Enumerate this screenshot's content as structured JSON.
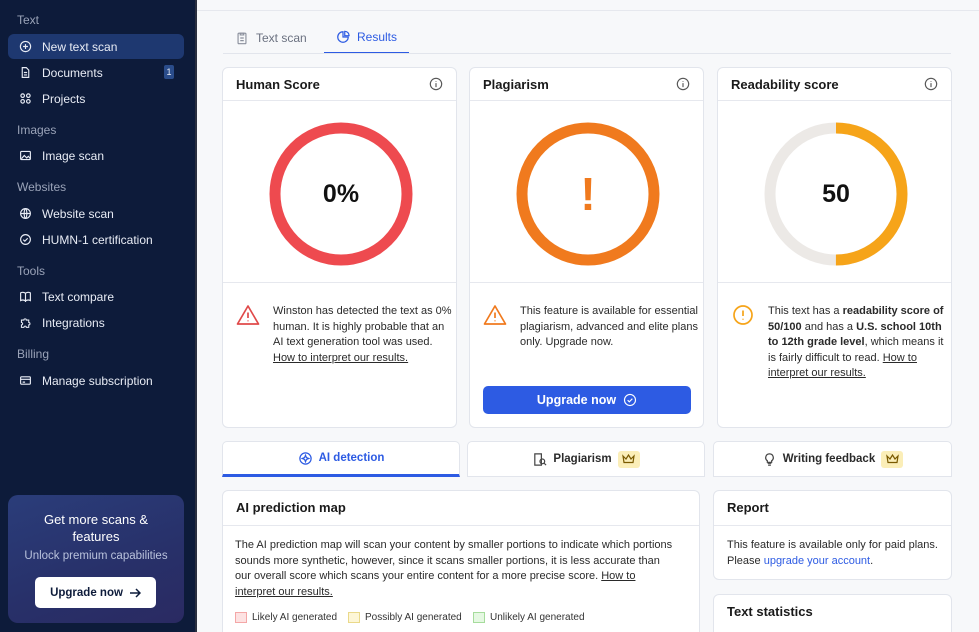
{
  "sidebar": {
    "sections": {
      "text": "Text",
      "images": "Images",
      "websites": "Websites",
      "tools": "Tools",
      "billing": "Billing"
    },
    "items": {
      "new_text_scan": "New text scan",
      "documents": "Documents",
      "documents_badge": "1",
      "projects": "Projects",
      "image_scan": "Image scan",
      "website_scan": "Website scan",
      "humn_cert": "HUMN-1 certification",
      "text_compare": "Text compare",
      "integrations": "Integrations",
      "manage_subscription": "Manage subscription"
    },
    "promo": {
      "title": "Get more scans & features",
      "subtitle": "Unlock premium capabilities",
      "button": "Upgrade now"
    }
  },
  "tabs": {
    "text_scan": "Text scan",
    "results": "Results"
  },
  "cards": {
    "human": {
      "title": "Human Score",
      "value": "0%",
      "score_percent": 0,
      "msg": "Winston has detected the text as 0% human. It is highly probable that an AI text generation tool was used.",
      "link": "How to interpret our results."
    },
    "plagiarism": {
      "title": "Plagiarism",
      "value": "!",
      "msg": "This feature is available for essential plagiarism, advanced and elite plans only. Upgrade now.",
      "button": "Upgrade now"
    },
    "readability": {
      "title": "Readability score",
      "value": "50",
      "score": 50,
      "msg_1": "This text has a ",
      "msg_b1": "readability score of 50/100",
      "msg_2": " and has a ",
      "msg_b2": "U.S. school 10th to 12th grade level",
      "msg_3": ", which means it is fairly difficult to read. ",
      "link": "How to interpret our results."
    }
  },
  "subtabs": {
    "ai_detection": "AI detection",
    "plagiarism": "Plagiarism",
    "writing_feedback": "Writing feedback"
  },
  "prediction_map": {
    "title": "AI prediction map",
    "desc": "The AI prediction map will scan your content by smaller portions to indicate which portions sounds more synthetic, however, since it scans smaller portions, it is less accurate than our overall score which scans your entire content for a more precise score. ",
    "link": "How to interpret our results.",
    "legend": {
      "likely": "Likely AI generated",
      "possibly": "Possibly AI generated",
      "unlikely": "Unlikely AI generated"
    }
  },
  "report": {
    "title": "Report",
    "text": "This feature is available only for paid plans. Please ",
    "link": "upgrade your account",
    "end": "."
  },
  "text_statistics": {
    "title": "Text statistics"
  },
  "colors": {
    "sidebar_bg": "#0d1b3a",
    "accent": "#2d5be3",
    "human_gauge": "#ee4a4f",
    "plagiarism_gauge": "#f07a1e",
    "readability_gauge": "#f6a419",
    "gauge_track": "#ece9e6"
  }
}
